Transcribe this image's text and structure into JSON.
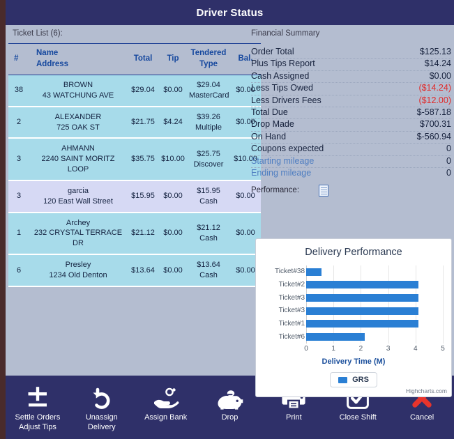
{
  "window": {
    "title": "Driver Status"
  },
  "ticket_panel": {
    "caption": "Ticket List (6):",
    "columns": {
      "hash": "#",
      "name": "Name",
      "address": "Address",
      "total": "Total",
      "tip": "Tip",
      "tendered": "Tendered",
      "type": "Type",
      "bal": "Bal."
    },
    "rows": [
      {
        "num": "38",
        "name": "BROWN",
        "address": "43 WATCHUNG AVE",
        "total": "$29.04",
        "tip": "$0.00",
        "tendered": "$29.04",
        "type": "MasterCard",
        "bal": "$0.00",
        "shade": "cyan"
      },
      {
        "num": "2",
        "name": "ALEXANDER",
        "address": "725 OAK ST",
        "total": "$21.75",
        "tip": "$4.24",
        "tendered": "$39.26",
        "type": "Multiple",
        "bal": "$0.00",
        "shade": "cyan"
      },
      {
        "num": "3",
        "name": "AHMANN",
        "address": "2240 SAINT MORITZ LOOP",
        "total": "$35.75",
        "tip": "$10.00",
        "tendered": "$25.75",
        "type": "Discover",
        "bal": "$10.00",
        "shade": "cyan"
      },
      {
        "num": "3",
        "name": "garcia",
        "address": "120 East Wall Street",
        "total": "$15.95",
        "tip": "$0.00",
        "tendered": "$15.95",
        "type": "Cash",
        "bal": "$0.00",
        "shade": "lavender"
      },
      {
        "num": "1",
        "name": "Archey",
        "address": "232 CRYSTAL TERRACE DR",
        "total": "$21.12",
        "tip": "$0.00",
        "tendered": "$21.12",
        "type": "Cash",
        "bal": "$0.00",
        "shade": "cyan"
      },
      {
        "num": "6",
        "name": "Presley",
        "address": "1234 Old Denton",
        "total": "$13.64",
        "tip": "$0.00",
        "tendered": "$13.64",
        "type": "Cash",
        "bal": "$0.00",
        "shade": "cyan"
      }
    ]
  },
  "financial_summary": {
    "caption": "Financial Summary",
    "rows": [
      {
        "label": "Order Total",
        "value": "$125.13",
        "style": "normal"
      },
      {
        "label": "Plus Tips Report",
        "value": "$14.24",
        "style": "normal"
      },
      {
        "label": "Cash Assigned",
        "value": "$0.00",
        "style": "normal"
      },
      {
        "label": "Less Tips Owed",
        "value": "($14.24)",
        "style": "negative"
      },
      {
        "label": "Less Drivers Fees",
        "value": "($12.00)",
        "style": "negative"
      },
      {
        "label": "Total Due",
        "value": "$-587.18",
        "style": "normal"
      },
      {
        "label": "Drop Made",
        "value": "$700.31",
        "style": "normal"
      },
      {
        "label": "On Hand",
        "value": "$-560.94",
        "style": "normal"
      },
      {
        "label": "Coupons expected",
        "value": "0",
        "style": "normal"
      },
      {
        "label": "Starting mileage",
        "value": "0",
        "style": "link"
      },
      {
        "label": "Ending mileage",
        "value": "0",
        "style": "link"
      }
    ],
    "performance_label": "Performance:",
    "performance_icon": "document-icon"
  },
  "chart_data": {
    "type": "bar",
    "orientation": "horizontal",
    "title": "Delivery Performance",
    "categories": [
      "Ticket#38",
      "Ticket#2",
      "Ticket#3",
      "Ticket#3",
      "Ticket#1",
      "Ticket#6"
    ],
    "series": [
      {
        "name": "GRS",
        "values": [
          0.55,
          4.1,
          4.1,
          4.1,
          4.1,
          2.15
        ],
        "color": "#2a7fd4"
      }
    ],
    "xlabel": "Delivery Time (M)",
    "ylabel": "",
    "xlim": [
      0,
      5
    ],
    "xticks": [
      "0",
      "1",
      "2",
      "3",
      "4",
      "5"
    ],
    "grid": true,
    "legend_position": "bottom",
    "legend": [
      "GRS"
    ],
    "credits": "Highcharts.com"
  },
  "toolbar": {
    "buttons": [
      {
        "id": "settle-orders-adjust-tips",
        "label": "Settle Orders\nAdjust Tips",
        "icon": "plus-minus-icon"
      },
      {
        "id": "unassign-delivery",
        "label": "Unassign\nDelivery",
        "icon": "undo-arrow-icon"
      },
      {
        "id": "assign-bank",
        "label": "Assign Bank",
        "icon": "hand-coin-icon"
      },
      {
        "id": "drop",
        "label": "Drop",
        "icon": "piggy-bank-icon"
      },
      {
        "id": "print",
        "label": "Print",
        "icon": "printer-icon"
      },
      {
        "id": "close-shift",
        "label": "Close Shift",
        "icon": "check-box-icon"
      },
      {
        "id": "cancel",
        "label": "Cancel",
        "icon": "red-x-icon"
      }
    ]
  },
  "colors": {
    "titlebar": "#2f3069",
    "panel_bg": "#b4bdd0",
    "row_cyan": "#a7dbea",
    "row_lavender": "#d6d9f4",
    "header_text": "#16489e",
    "negative": "#e02b2b",
    "link": "#4f7ec1",
    "bar": "#2a7fd4",
    "cancel": "#e8342c"
  }
}
